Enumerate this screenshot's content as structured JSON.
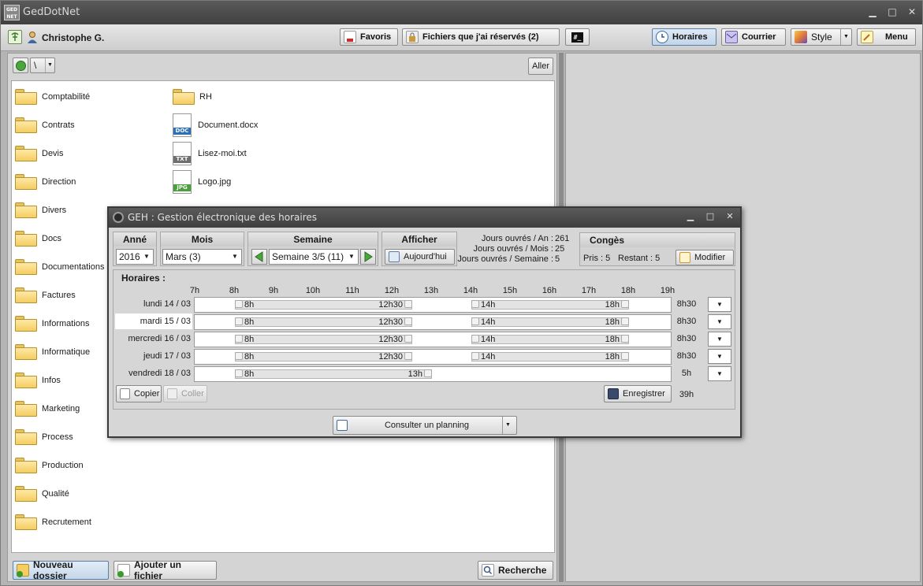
{
  "window": {
    "title": "GedDotNet",
    "minimize": "▁",
    "maximize": "□",
    "close": "✕"
  },
  "toolbar": {
    "user": "Christophe G.",
    "favoris": "Favoris",
    "reserved": "Fichiers que j'ai réservés (2)",
    "console": "#_",
    "horaires": "Horaires",
    "courrier": "Courrier",
    "style": "Style",
    "menu": "Menu"
  },
  "explorer": {
    "path_sep": "\\",
    "aller": "Aller",
    "folders": [
      "Comptabilité",
      "Contrats",
      "Devis",
      "Direction",
      "Divers",
      "Docs",
      "Documentations",
      "Factures",
      "Informations",
      "Informatique",
      "Infos",
      "Marketing",
      "Process",
      "Production",
      "Qualité",
      "Recrutement"
    ],
    "column2": [
      {
        "name": "RH",
        "kind": "folder"
      },
      {
        "name": "Document.docx",
        "kind": "doc",
        "tag": "DOC",
        "color": "#2a6fb8"
      },
      {
        "name": "Lisez-moi.txt",
        "kind": "doc",
        "tag": "TXT",
        "color": "#6f6f6f"
      },
      {
        "name": "Logo.jpg",
        "kind": "doc",
        "tag": "JPG",
        "color": "#4aa03c"
      }
    ],
    "new_folder": "Nouveau dossier",
    "add_file": "Ajouter un fichier",
    "search": "Recherche"
  },
  "geh": {
    "title": "GEH : Gestion électronique des horaires",
    "annee_label": "Anné",
    "annee_value": "2016",
    "mois_label": "Mois",
    "mois_value": "Mars (3)",
    "semaine_label": "Semaine",
    "semaine_value": "Semaine 3/5 (11)",
    "afficher_label": "Afficher",
    "aujourdhui": "Aujourd'hui",
    "stats": [
      {
        "label": "Jours ouvrés / An :",
        "value": "261"
      },
      {
        "label": "Jours ouvrés / Mois :",
        "value": "25"
      },
      {
        "label": "Jours ouvrés / Semaine :",
        "value": "5"
      }
    ],
    "conges_label": "Congès",
    "pris": "Pris : 5",
    "restant": "Restant : 5",
    "modifier": "Modifier",
    "horaires_label": "Horaires :",
    "hours": [
      "7h",
      "8h",
      "9h",
      "10h",
      "11h",
      "12h",
      "13h",
      "14h",
      "15h",
      "16h",
      "17h",
      "18h",
      "19h"
    ],
    "days": [
      {
        "dayname": "lundi",
        "date": "14 / 03",
        "total": "8h30",
        "slots": [
          {
            "start": "8h",
            "end": "12h30"
          },
          {
            "start": "14h",
            "end": "18h"
          }
        ]
      },
      {
        "dayname": "mardi",
        "date": "15 / 03",
        "total": "8h30",
        "slots": [
          {
            "start": "8h",
            "end": "12h30"
          },
          {
            "start": "14h",
            "end": "18h"
          }
        ]
      },
      {
        "dayname": "mercredi",
        "date": "16 / 03",
        "total": "8h30",
        "slots": [
          {
            "start": "8h",
            "end": "12h30"
          },
          {
            "start": "14h",
            "end": "18h"
          }
        ]
      },
      {
        "dayname": "jeudi",
        "date": "17 / 03",
        "total": "8h30",
        "slots": [
          {
            "start": "8h",
            "end": "12h30"
          },
          {
            "start": "14h",
            "end": "18h"
          }
        ]
      },
      {
        "dayname": "vendredi",
        "date": "18 / 03",
        "total": "5h",
        "slots": [
          {
            "start": "8h",
            "end": "13h"
          }
        ]
      }
    ],
    "copier": "Copier",
    "coller": "Coller",
    "enregistrer": "Enregistrer",
    "week_total": "39h",
    "consulter": "Consulter un planning"
  },
  "colors": {
    "accent": "#5a7fa8",
    "folder": "#f5cd61",
    "titlebar": "#404040"
  }
}
